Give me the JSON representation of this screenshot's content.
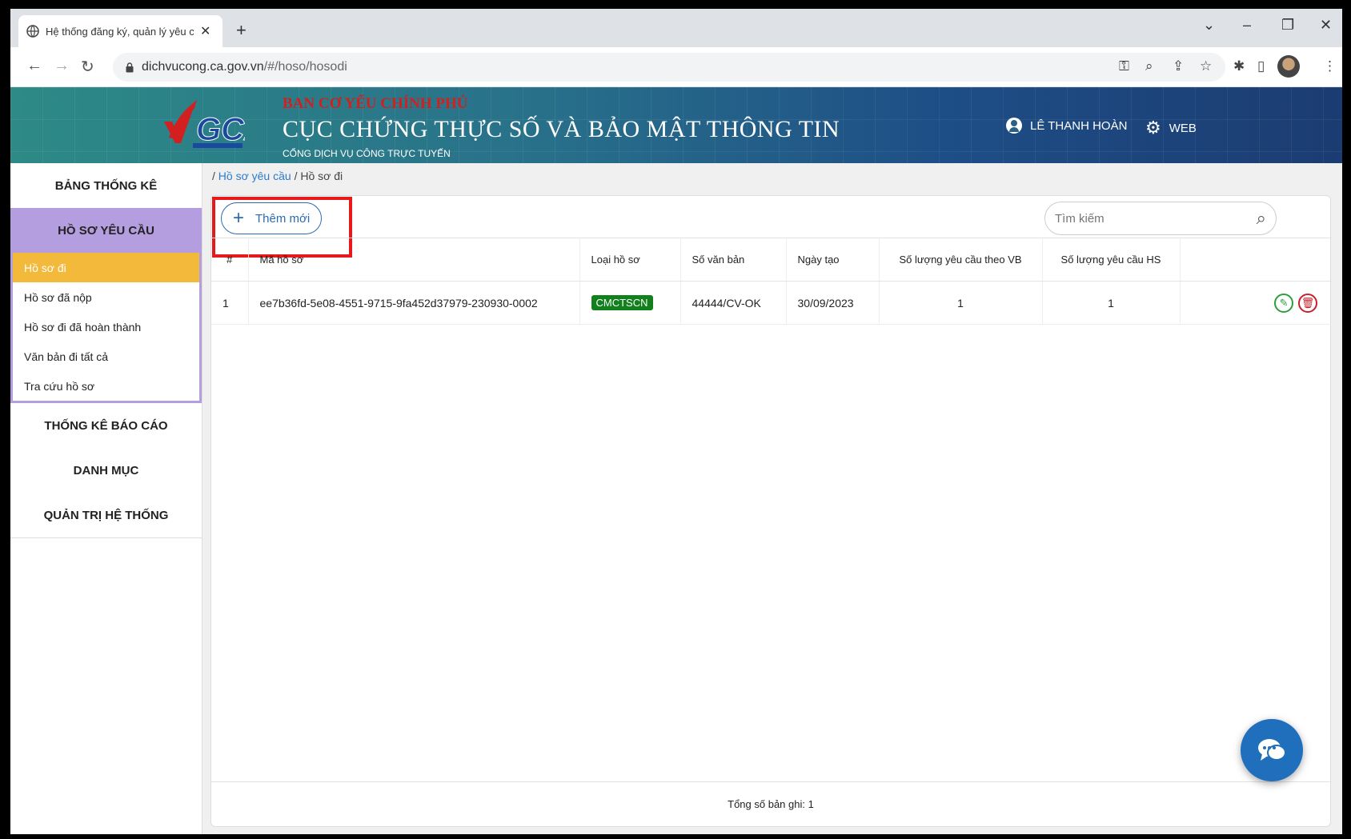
{
  "browser": {
    "tab_title": "Hệ thống đăng ký, quản lý yêu c",
    "tab_close": "✕",
    "new_tab": "+",
    "url_host": "dichvucong.ca.gov.vn",
    "url_path": "/#/hoso/hosodi"
  },
  "header": {
    "org_top": "BAN CƠ YẾU CHÍNH PHỦ",
    "org_main": "CỤC CHỨNG THỰC SỐ VÀ BẢO MẬT THÔNG TIN",
    "org_sub": "CỔNG DỊCH VỤ CÔNG TRỰC TUYẾN",
    "logo_text": "GCA",
    "user_name": "LÊ THANH HOÀN",
    "web_label": "WEB"
  },
  "sidebar": {
    "stats": "BẢNG THỐNG KÊ",
    "requests_group": "HỒ SƠ YÊU CẦU",
    "sub_items": [
      "Hồ sơ đi",
      "Hồ sơ đã nộp",
      "Hồ sơ đi đã hoàn thành",
      "Văn bản đi tất cả",
      "Tra cứu hồ sơ"
    ],
    "reports": "THỐNG KÊ BÁO CÁO",
    "catalog": "DANH MỤC",
    "admin": "QUẢN TRỊ HỆ THỐNG"
  },
  "breadcrumb": {
    "sep": "/",
    "parent": "Hồ sơ yêu cầu",
    "current": "Hồ sơ đi"
  },
  "toolbar": {
    "add_label": "Thêm mới",
    "search_placeholder": "Tìm kiếm"
  },
  "table": {
    "headers": [
      "#",
      "Mã hồ sơ",
      "Loại hồ sơ",
      "Số văn bản",
      "Ngày tạo",
      "Số lượng yêu cầu theo VB",
      "Số lượng yêu cầu HS",
      ""
    ],
    "rows": [
      {
        "index": "1",
        "code": "ee7b36fd-5e08-4551-9715-9fa452d37979-230930-0002",
        "type": "CMCTSCN",
        "doc_no": "44444/CV-OK",
        "created": "30/09/2023",
        "qty_vb": "1",
        "qty_hs": "1"
      }
    ]
  },
  "footer": {
    "total_label": "Tổng số bản ghi: 1"
  },
  "colors": {
    "header_gradient_start": "#2d8a86",
    "header_gradient_end": "#1b3c72",
    "sidebar_group": "#b49ee0",
    "sidebar_active": "#f2b93a",
    "tag_green": "#12801c",
    "highlight_red": "#e8191b",
    "chat_blue": "#1f6fbd"
  }
}
